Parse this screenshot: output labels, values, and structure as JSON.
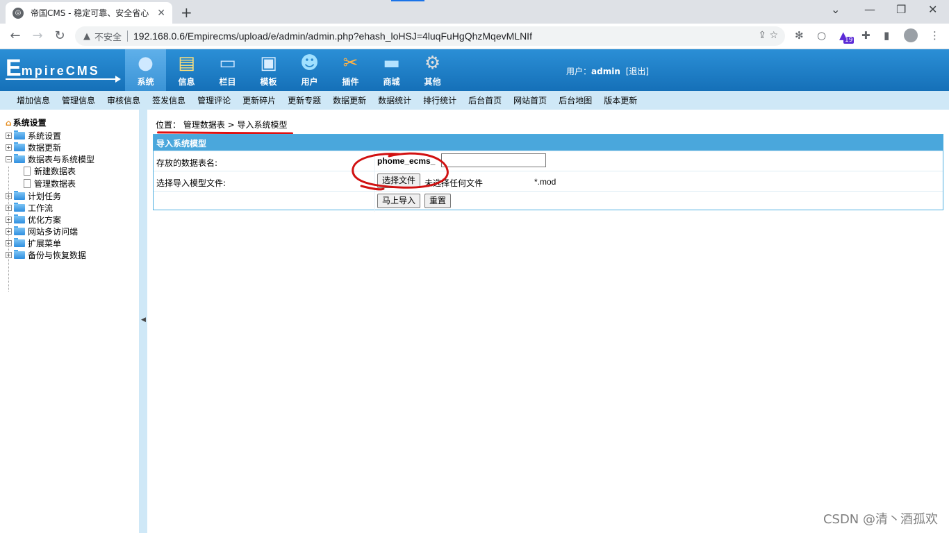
{
  "browser": {
    "tab_title": "帝国CMS - 稳定可靠、安全省心",
    "insecure_label": "不安全",
    "url": "192.168.0.6/Empirecms/upload/e/admin/admin.php?ehash_loHSJ=4luqFuHgQhzMqevMLNIf",
    "extension_badge": "19"
  },
  "header": {
    "logo_letter": "E",
    "logo_rest": "mpireCMS",
    "nav": [
      "系统",
      "信息",
      "栏目",
      "模板",
      "用户",
      "插件",
      "商城",
      "其他"
    ],
    "active_nav": "系统",
    "user_prefix": "用户：",
    "username": "admin",
    "logout": "[退出]"
  },
  "submenu": [
    "增加信息",
    "管理信息",
    "审核信息",
    "签发信息",
    "管理评论",
    "更新碎片",
    "更新专题",
    "数据更新",
    "数据统计",
    "排行统计",
    "后台首页",
    "网站首页",
    "后台地图",
    "版本更新"
  ],
  "sidebar": {
    "root": "系统设置",
    "items": [
      "系统设置",
      "数据更新",
      "数据表与系统模型"
    ],
    "children": [
      "新建数据表",
      "管理数据表"
    ],
    "items_after": [
      "计划任务",
      "工作流",
      "优化方案",
      "网站多访问端",
      "扩展菜单",
      "备份与恢复数据"
    ]
  },
  "breadcrumb": {
    "prefix": "位置：",
    "link": "管理数据表",
    "sep": " > ",
    "current": "导入系统模型"
  },
  "form": {
    "title": "导入系统模型",
    "table_label": "存放的数据表名:",
    "table_prefix": "phome_ecms_",
    "table_value": "",
    "file_label": "选择导入模型文件:",
    "choose_file": "选择文件",
    "no_file": "未选择任何文件",
    "ext_hint": "*.mod",
    "submit": "马上导入",
    "reset": "重置"
  },
  "watermark": "CSDN @清丶酒孤欢",
  "colors": {
    "header_blue": "#1570b8",
    "submenu_bg": "#cfe8f7",
    "panel_head": "#4aa7dc",
    "annotation_red": "#d11111"
  }
}
